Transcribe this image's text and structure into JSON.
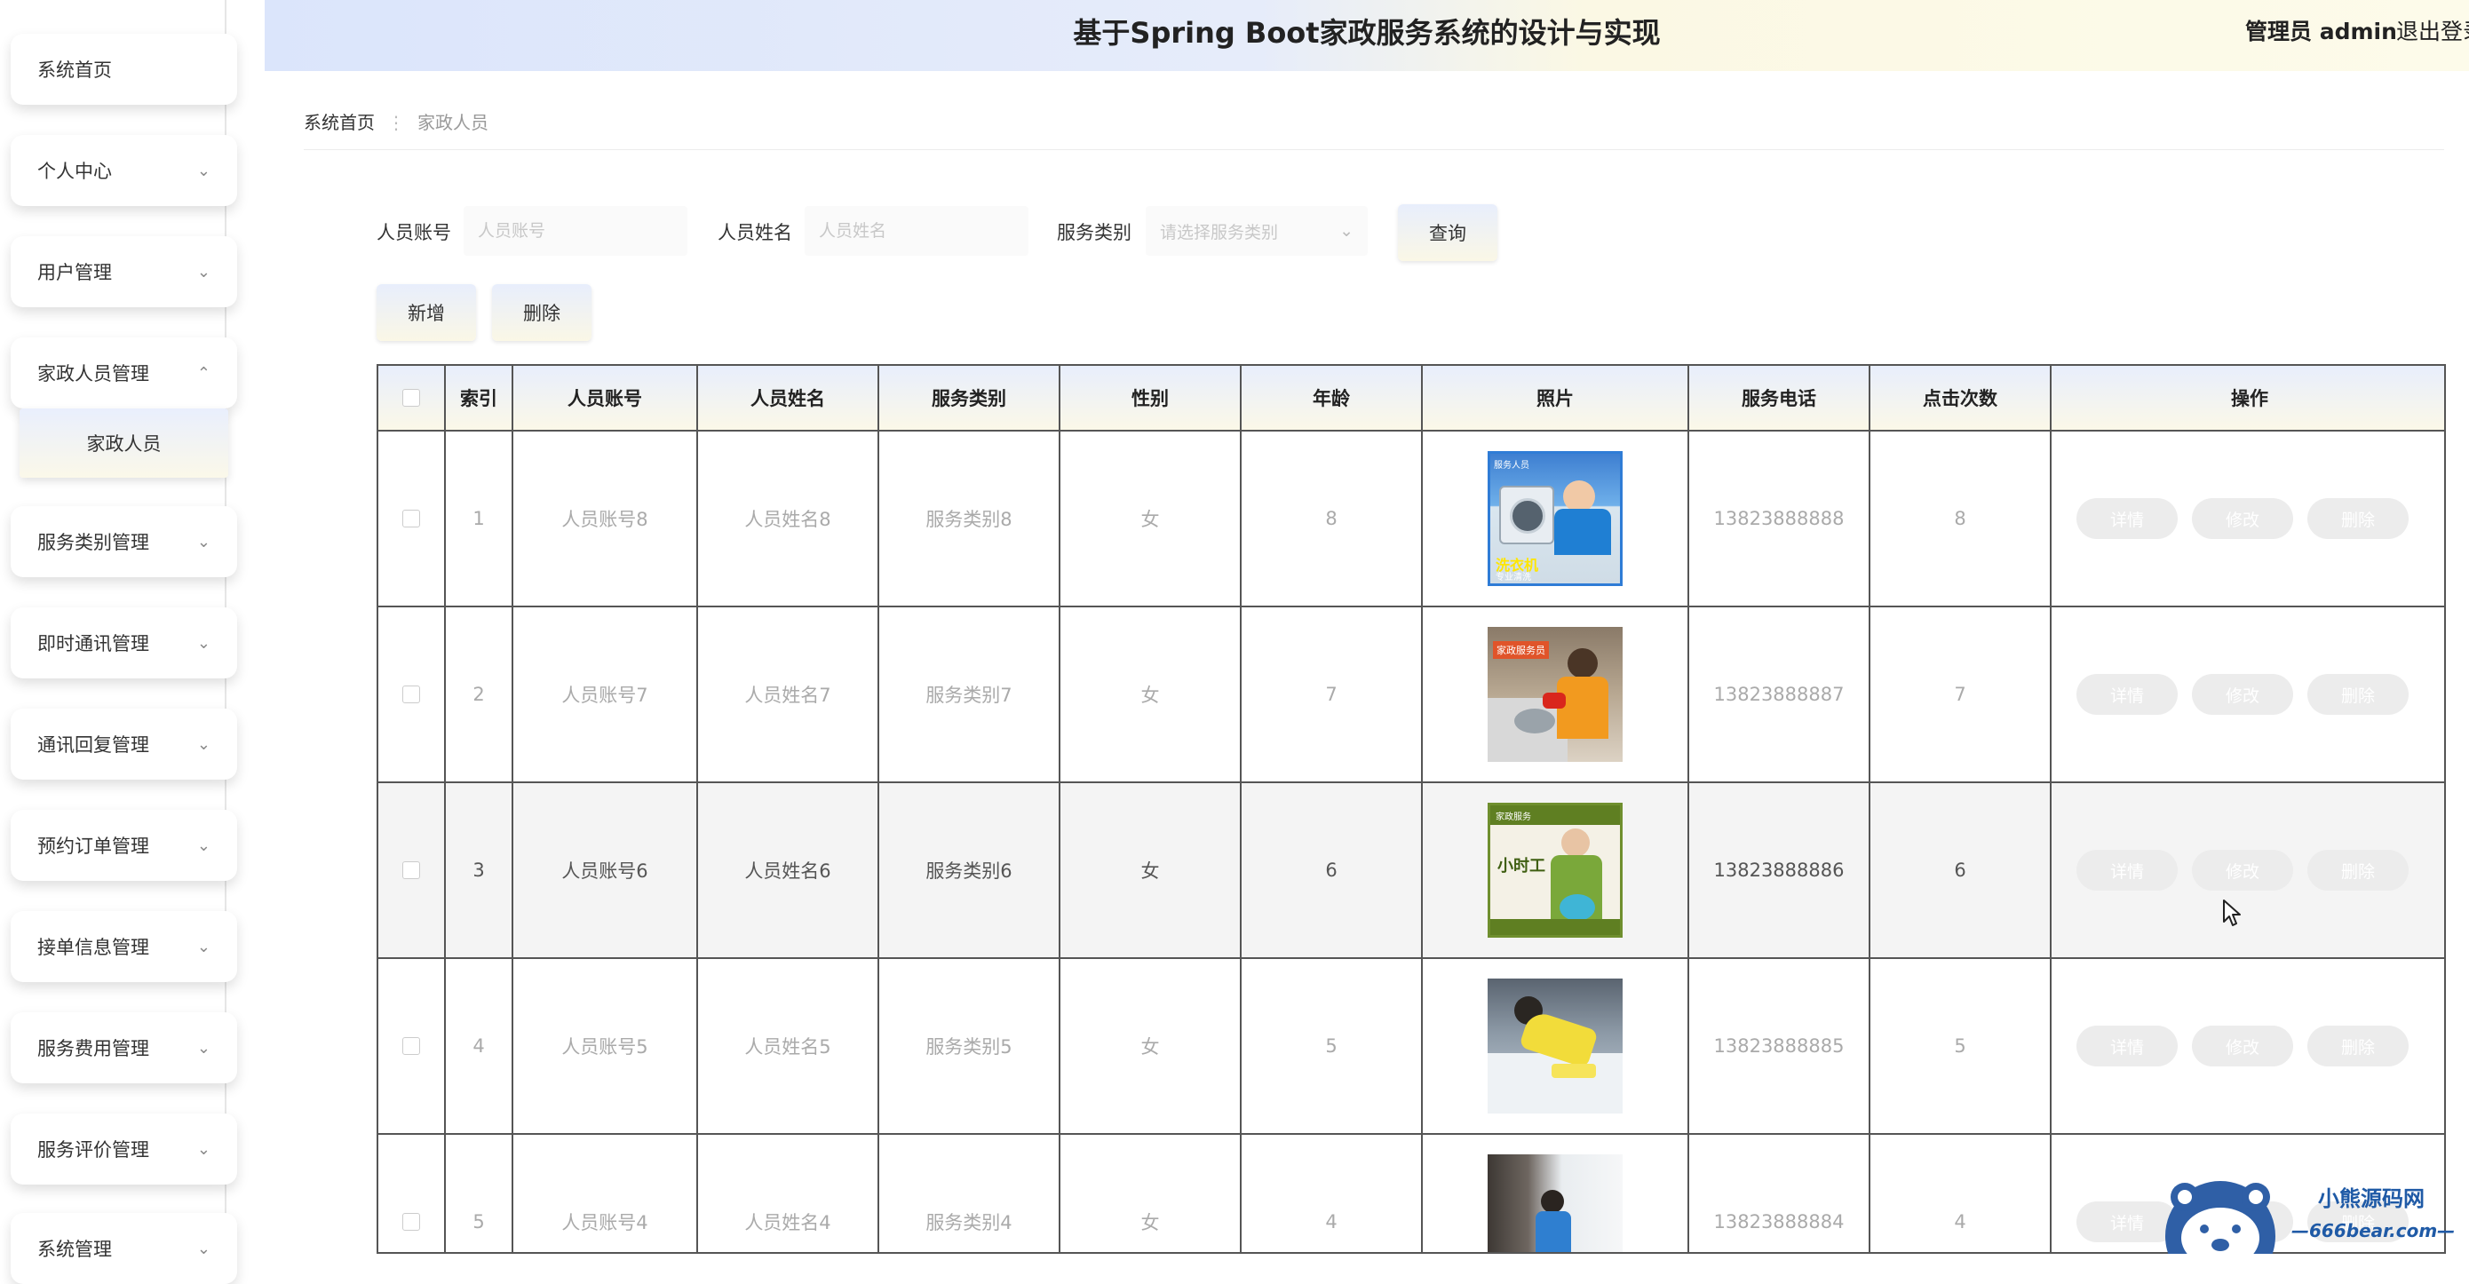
{
  "sidebar": {
    "items": [
      {
        "label": "系统首页",
        "expandable": false
      },
      {
        "label": "个人中心",
        "expandable": true
      },
      {
        "label": "用户管理",
        "expandable": true
      },
      {
        "label": "家政人员管理",
        "expandable": true,
        "expanded": true
      },
      {
        "label": "服务类别管理",
        "expandable": true
      },
      {
        "label": "即时通讯管理",
        "expandable": true
      },
      {
        "label": "通讯回复管理",
        "expandable": true
      },
      {
        "label": "预约订单管理",
        "expandable": true
      },
      {
        "label": "接单信息管理",
        "expandable": true
      },
      {
        "label": "服务费用管理",
        "expandable": true
      },
      {
        "label": "服务评价管理",
        "expandable": true
      },
      {
        "label": "系统管理",
        "expandable": true
      }
    ],
    "submenu": {
      "label": "家政人员"
    }
  },
  "header": {
    "title": "基于Spring Boot家政服务系统的设计与实现",
    "user": "管理员 admin",
    "logout": "退出登录"
  },
  "breadcrumb": {
    "home": "系统首页",
    "separator": "⋮",
    "current": "家政人员"
  },
  "search": {
    "account_label": "人员账号",
    "account_placeholder": "人员账号",
    "name_label": "人员姓名",
    "name_placeholder": "人员姓名",
    "category_label": "服务类别",
    "category_placeholder": "请选择服务类别",
    "query_button": "查询"
  },
  "actions": {
    "add_button": "新增",
    "delete_button": "删除"
  },
  "table": {
    "columns": [
      "索引",
      "人员账号",
      "人员姓名",
      "服务类别",
      "性别",
      "年龄",
      "照片",
      "服务电话",
      "点击次数",
      "操作"
    ],
    "rows": [
      {
        "index": "1",
        "account": "人员账号8",
        "name": "人员姓名8",
        "category": "服务类别8",
        "gender": "女",
        "age": "8",
        "phone": "13823888888",
        "clicks": "8"
      },
      {
        "index": "2",
        "account": "人员账号7",
        "name": "人员姓名7",
        "category": "服务类别7",
        "gender": "女",
        "age": "7",
        "phone": "13823888887",
        "clicks": "7"
      },
      {
        "index": "3",
        "account": "人员账号6",
        "name": "人员姓名6",
        "category": "服务类别6",
        "gender": "女",
        "age": "6",
        "phone": "13823888886",
        "clicks": "6"
      },
      {
        "index": "4",
        "account": "人员账号5",
        "name": "人员姓名5",
        "category": "服务类别5",
        "gender": "女",
        "age": "5",
        "phone": "13823888885",
        "clicks": "5"
      },
      {
        "index": "5",
        "account": "人员账号4",
        "name": "人员姓名4",
        "category": "服务类别4",
        "gender": "女",
        "age": "4",
        "phone": "13823888884",
        "clicks": "4"
      }
    ],
    "row_actions": {
      "detail": "详情",
      "edit": "修改",
      "delete": "删除"
    },
    "photo_texts": {
      "photo1_top": "服务人员",
      "photo1_big": "洗衣机",
      "photo1_sub": "专业清洗",
      "photo2_tag": "家政服务员",
      "photo3_top": "家政服务",
      "photo3_big": "小时工"
    }
  },
  "watermark": {
    "title": "小熊源码网",
    "url": "—666bear.com—"
  },
  "colors": {
    "header_left": "#dbe5fb",
    "header_right": "#fdfbea",
    "border": "#555555",
    "watermark_blue": "#1f5aa6"
  }
}
